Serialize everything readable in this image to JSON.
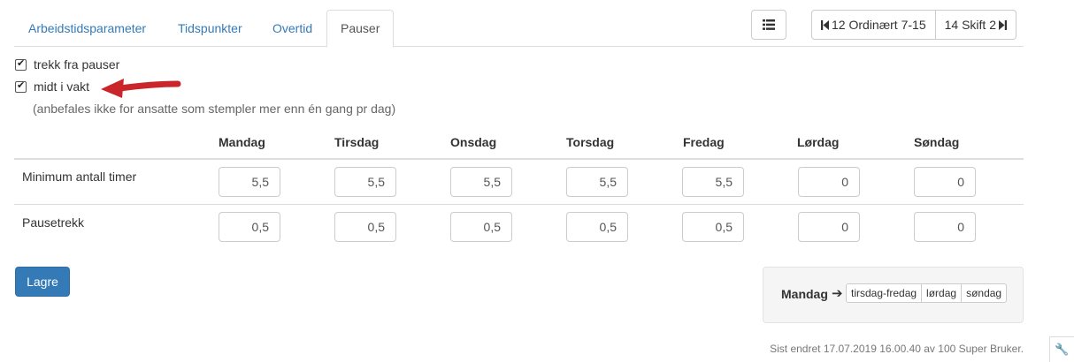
{
  "tabs": [
    {
      "label": "Arbeidstidsparameter"
    },
    {
      "label": "Tidspunkter"
    },
    {
      "label": "Overtid"
    },
    {
      "label": "Pauser"
    }
  ],
  "toolbar": {
    "list_icon": "list-icon",
    "prev_label": "12 Ordinært 7-15",
    "next_label": "14 Skift 2",
    "prev_icon": "step-backward-icon",
    "next_icon": "step-forward-icon"
  },
  "options": {
    "deduct_breaks": {
      "label": "trekk fra pauser",
      "checked": true
    },
    "mid_shift": {
      "label": "midt i vakt",
      "checked": true
    },
    "hint": "(anbefales ikke for ansatte som stempler mer enn én gang pr dag)"
  },
  "table": {
    "days": [
      "Mandag",
      "Tirsdag",
      "Onsdag",
      "Torsdag",
      "Fredag",
      "Lørdag",
      "Søndag"
    ],
    "rows": [
      {
        "label": "Minimum antall timer",
        "values": [
          "5,5",
          "5,5",
          "5,5",
          "5,5",
          "5,5",
          "0",
          "0"
        ]
      },
      {
        "label": "Pausetrekk",
        "values": [
          "0,5",
          "0,5",
          "0,5",
          "0,5",
          "0,5",
          "0",
          "0"
        ]
      }
    ]
  },
  "save_label": "Lagre",
  "copy": {
    "day": "Mandag",
    "targets": [
      "tirsdag-fredag",
      "lørdag",
      "søndag"
    ]
  },
  "footer": "Sist endret 17.07.2019 16.00.40 av 100 Super Bruker.",
  "colors": {
    "primary": "#337ab7",
    "annotation_arrow": "#c9252b"
  }
}
